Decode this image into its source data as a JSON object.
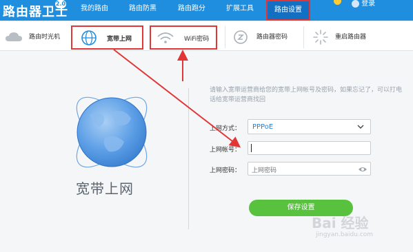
{
  "header": {
    "app_title": "路由器卫士",
    "version_badge": "2.0",
    "tabs": [
      {
        "label": "我的路由",
        "active": false
      },
      {
        "label": "路由防黑",
        "active": false
      },
      {
        "label": "路由跑分",
        "active": false
      },
      {
        "label": "扩展工具",
        "active": false
      },
      {
        "label": "路由设置",
        "active": true
      }
    ],
    "user_label": "登录"
  },
  "subbar": {
    "items": [
      {
        "label": "路由时光机",
        "icon": "cloud-icon"
      },
      {
        "label": "宽带上网",
        "icon": "globe-icon",
        "highlighted": true
      },
      {
        "label": "WiFi密码",
        "icon": "wifi-icon",
        "highlighted": true
      },
      {
        "label": "路由器密码",
        "icon": "lock-icon"
      },
      {
        "label": "重启路由器",
        "icon": "restart-icon"
      }
    ]
  },
  "main": {
    "illustration_caption": "宽带上网",
    "hint": "请输入宽带运营商给您的宽带上网帐号及密码，如果忘记了，可以打电话给宽带运营商找回",
    "form": {
      "method_label": "上网方式：",
      "method_value": "PPPoE",
      "account_label": "上网帐号：",
      "account_value": "",
      "password_label": "上网密码：",
      "password_placeholder": "上网密码"
    },
    "save_label": "保存设置"
  },
  "watermark": {
    "brand": "Bai 经验",
    "url": "jingyan.baidu.com"
  },
  "colors": {
    "header_bg": "#1f8ede",
    "active_tab_bg": "#136fc1",
    "annotation_red": "#e23636",
    "save_button": "#58c23f",
    "select_value": "#1f7fd6"
  }
}
